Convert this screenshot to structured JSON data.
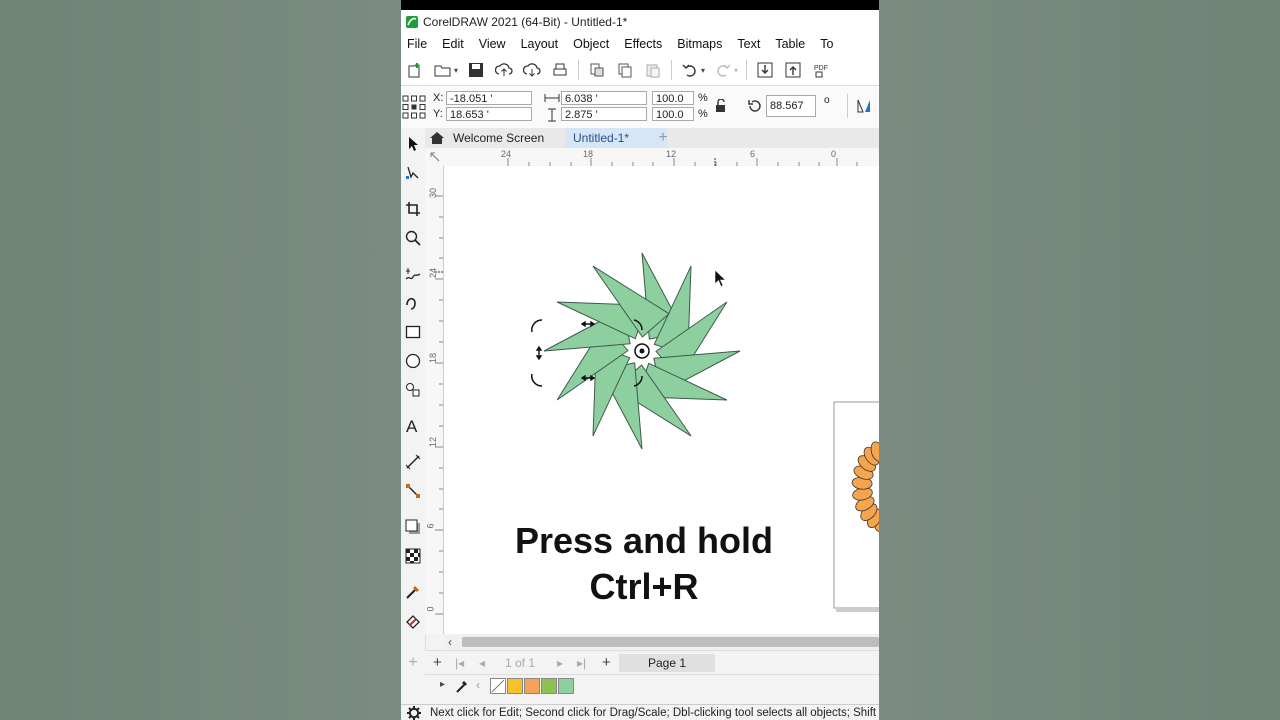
{
  "window": {
    "title": "CorelDRAW 2021 (64-Bit) - Untitled-1*"
  },
  "menu": {
    "items": [
      "File",
      "Edit",
      "View",
      "Layout",
      "Object",
      "Effects",
      "Bitmaps",
      "Text",
      "Table",
      "To"
    ]
  },
  "property_bar": {
    "x_label": "X:",
    "x_value": "-18.051 '",
    "y_label": "Y:",
    "y_value": "18.653 '",
    "w_value": "6.038 '",
    "h_value": "2.875 '",
    "scale_x": "100.0",
    "scale_y": "100.0",
    "percent_x": "%",
    "percent_y": "%",
    "rotation": "88.567",
    "degree_symbol": "o"
  },
  "tabs": {
    "welcome": "Welcome Screen",
    "document": "Untitled-1*",
    "add": "+"
  },
  "ruler": {
    "h_ticks": [
      "24",
      "18",
      "12",
      "6",
      "0"
    ],
    "v_ticks": [
      "30",
      "24",
      "18",
      "12",
      "6",
      "0"
    ]
  },
  "caption": {
    "line1": "Press and hold",
    "line2": "Ctrl+R"
  },
  "page_nav": {
    "add_before": "+",
    "counter": "1 of 1",
    "add_after": "+",
    "page_tab": "Page 1"
  },
  "palette": {
    "colors": [
      "#ffffff",
      "#f6c12d",
      "#f5a25a",
      "#8dc253",
      "#8ecfa0"
    ]
  },
  "shape": {
    "fill": "#8ecfa0",
    "stroke": "#3d5a4a",
    "secondary_fill": "#f6a54e"
  },
  "status": {
    "text": "Next click for Edit; Second click for Drag/Scale; Dbl-clicking tool selects all objects; Shift"
  }
}
